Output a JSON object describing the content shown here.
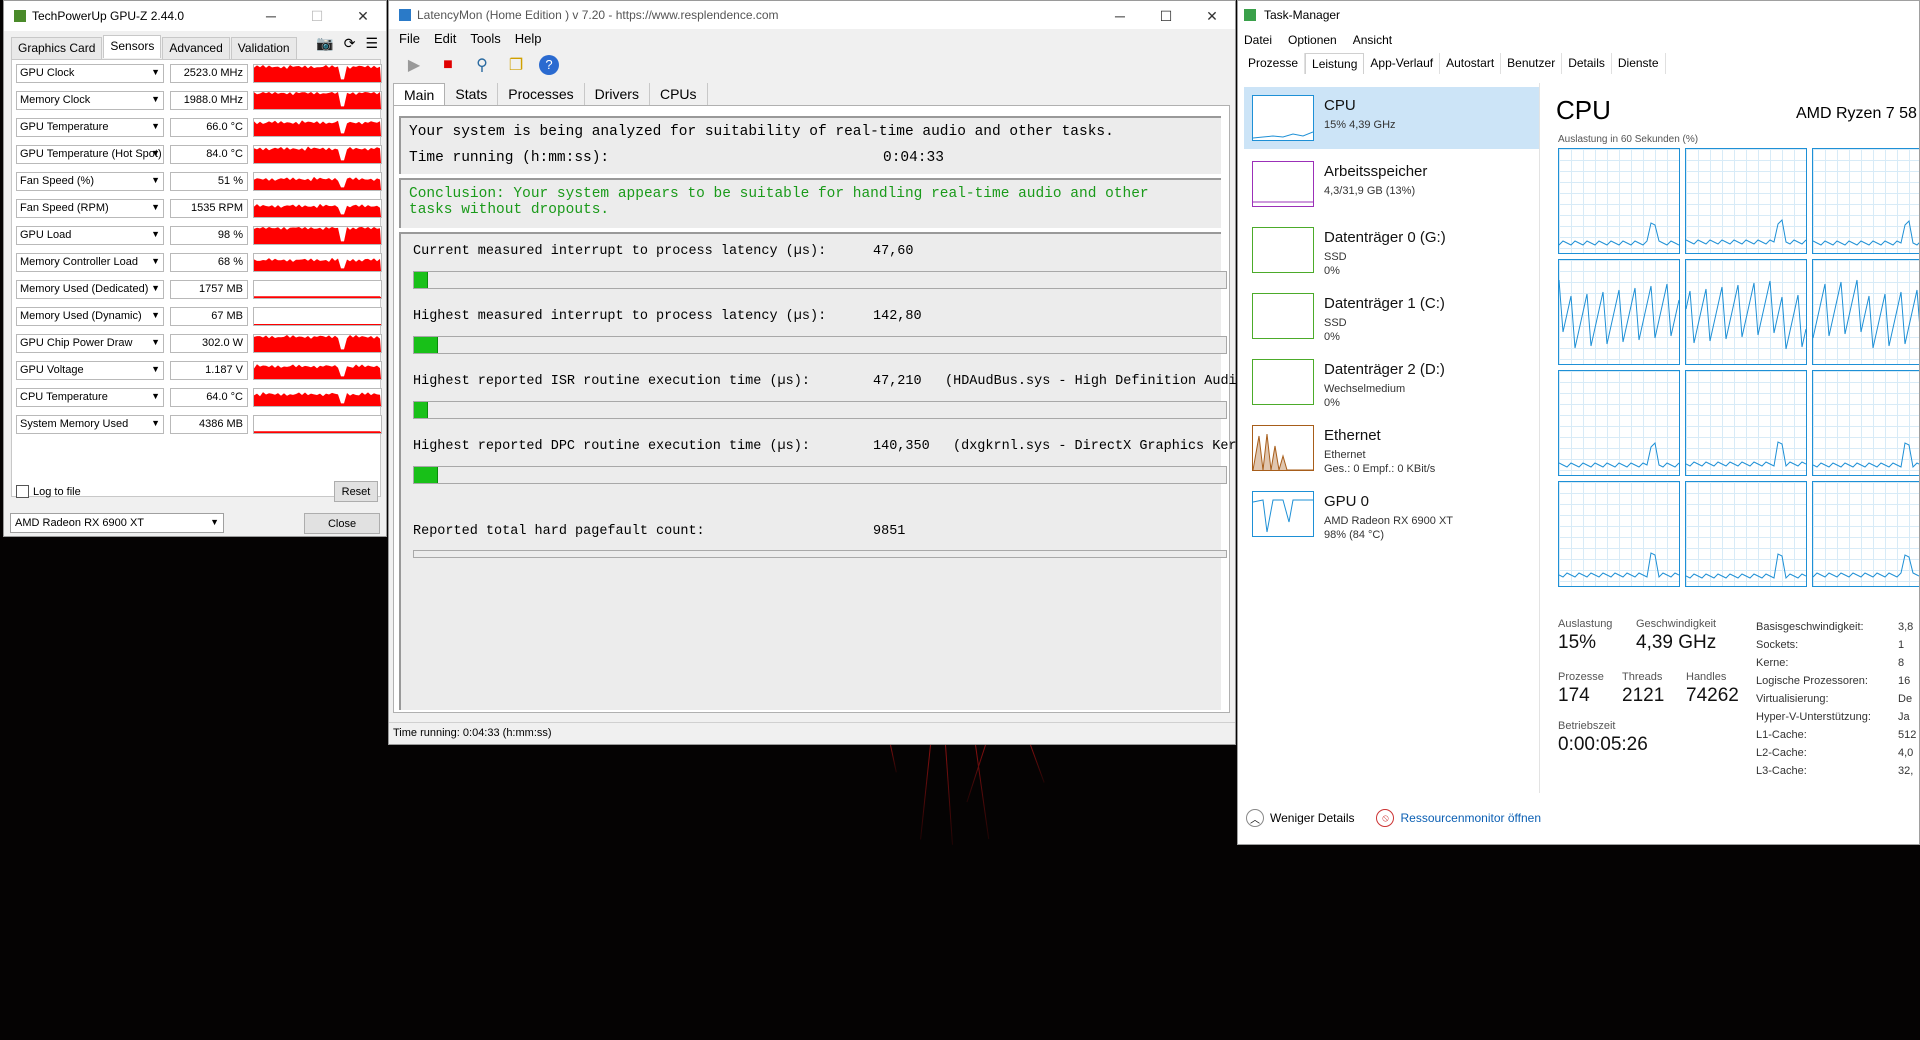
{
  "gpuz": {
    "title": "TechPowerUp GPU-Z 2.44.0",
    "tabs": [
      "Graphics Card",
      "Sensors",
      "Advanced",
      "Validation"
    ],
    "active_tab": "Sensors",
    "sensors": [
      {
        "label": "GPU Clock",
        "value": "2523.0 MHz",
        "level": 0.85
      },
      {
        "label": "Memory Clock",
        "value": "1988.0 MHz",
        "level": 0.9
      },
      {
        "label": "GPU Temperature",
        "value": "66.0 °C",
        "level": 0.75
      },
      {
        "label": "GPU Temperature (Hot Spot)",
        "value": "84.0 °C",
        "level": 0.8
      },
      {
        "label": "Fan Speed (%)",
        "value": "51 %",
        "level": 0.6
      },
      {
        "label": "Fan Speed (RPM)",
        "value": "1535 RPM",
        "level": 0.6
      },
      {
        "label": "GPU Load",
        "value": "98 %",
        "level": 0.9
      },
      {
        "label": "Memory Controller Load",
        "value": "68 %",
        "level": 0.6
      },
      {
        "label": "Memory Used (Dedicated)",
        "value": "1757 MB",
        "level": 0.1
      },
      {
        "label": "Memory Used (Dynamic)",
        "value": "67 MB",
        "level": 0.0
      },
      {
        "label": "GPU Chip Power Draw",
        "value": "302.0 W",
        "level": 0.85
      },
      {
        "label": "GPU Voltage",
        "value": "1.187 V",
        "level": 0.7
      },
      {
        "label": "CPU Temperature",
        "value": "64.0 °C",
        "level": 0.65
      },
      {
        "label": "System Memory Used",
        "value": "4386 MB",
        "level": 0.1
      }
    ],
    "log_to_file": "Log to file",
    "reset": "Reset",
    "gpu_select": "AMD Radeon RX 6900 XT",
    "close": "Close",
    "graph_color": "#ff0000"
  },
  "latencymon": {
    "title": "LatencyMon  (Home Edition )  v 7.20 - https://www.resplendence.com",
    "menu": [
      "File",
      "Edit",
      "Tools",
      "Help"
    ],
    "tabs": [
      "Main",
      "Stats",
      "Processes",
      "Drivers",
      "CPUs"
    ],
    "active_tab": "Main",
    "analysis_line": "Your system is being analyzed for suitability of real-time audio and other tasks.",
    "time_running_label": "Time running (h:mm:ss):",
    "time_running_value": "0:04:33",
    "conclusion_line1": "Conclusion: Your system appears to be suitable for handling real-time audio and other",
    "conclusion_line2": "tasks without dropouts.",
    "conclusion_color": "#1a9a1a",
    "measurements": [
      {
        "label": "Current measured interrupt to process latency (µs):",
        "value": "47,60",
        "detail": "",
        "bar_fraction": 0.015
      },
      {
        "label": "Highest measured interrupt to process latency (µs):",
        "value": "142,80",
        "detail": "",
        "bar_fraction": 0.03
      },
      {
        "label": "Highest reported ISR routine execution time (µs):",
        "value": "47,210",
        "detail": "(HDAudBus.sys - High Definition Audi",
        "bar_fraction": 0.015
      },
      {
        "label": "Highest reported DPC routine execution time (µs):",
        "value": "140,350",
        "detail": "(dxgkrnl.sys - DirectX Graphics Ker",
        "bar_fraction": 0.03
      }
    ],
    "pagefault_label": "Reported total hard pagefault count:",
    "pagefault_value": "9851",
    "status": "Time running: 0:04:33  (h:mm:ss)",
    "bar_color": "#18c018"
  },
  "taskmanager": {
    "title": "Task-Manager",
    "menu": [
      "Datei",
      "Optionen",
      "Ansicht"
    ],
    "tabs": [
      "Prozesse",
      "Leistung",
      "App-Verlauf",
      "Autostart",
      "Benutzer",
      "Details",
      "Dienste"
    ],
    "active_tab": "Leistung",
    "resources": [
      {
        "name": "CPU",
        "sub1": "15% 4,39 GHz",
        "sub2": "",
        "sub3": "",
        "color": "#1e90d6",
        "selected": true
      },
      {
        "name": "Arbeitsspeicher",
        "sub1": "4,3/31,9 GB (13%)",
        "sub2": "",
        "sub3": "",
        "color": "#9b30b8",
        "selected": false
      },
      {
        "name": "Datenträger 0 (G:)",
        "sub1": "SSD",
        "sub2": "0%",
        "sub3": "",
        "color": "#4cab2a",
        "selected": false
      },
      {
        "name": "Datenträger 1 (C:)",
        "sub1": "SSD",
        "sub2": "0%",
        "sub3": "",
        "color": "#4cab2a",
        "selected": false
      },
      {
        "name": "Datenträger 2 (D:)",
        "sub1": "Wechselmedium",
        "sub2": "0%",
        "sub3": "",
        "color": "#4cab2a",
        "selected": false
      },
      {
        "name": "Ethernet",
        "sub1": "Ethernet",
        "sub2": "Ges.: 0 Empf.: 0 KBit/s",
        "sub3": "",
        "color": "#a75d1a",
        "selected": false
      },
      {
        "name": "GPU 0",
        "sub1": "AMD Radeon RX 6900 XT",
        "sub2": "98% (84 °C)",
        "sub3": "",
        "color": "#1e90d6",
        "selected": false
      }
    ],
    "cpu_heading": "CPU",
    "cpu_model": "AMD Ryzen 7 58",
    "graph_label": "Auslastung in 60 Sekunden (%)",
    "stats": {
      "auslastung_label": "Auslastung",
      "auslastung": "15%",
      "geschwindigkeit_label": "Geschwindigkeit",
      "geschwindigkeit": "4,39 GHz",
      "prozesse_label": "Prozesse",
      "prozesse": "174",
      "threads_label": "Threads",
      "threads": "2121",
      "handles_label": "Handles",
      "handles": "74262",
      "betriebszeit_label": "Betriebszeit",
      "betriebszeit": "0:00:05:26"
    },
    "specs": [
      {
        "k": "Basisgeschwindigkeit:",
        "v": "3,8"
      },
      {
        "k": "Sockets:",
        "v": "1"
      },
      {
        "k": "Kerne:",
        "v": "8"
      },
      {
        "k": "Logische Prozessoren:",
        "v": "16"
      },
      {
        "k": "Virtualisierung:",
        "v": "De"
      },
      {
        "k": "Hyper-V-Unterstützung:",
        "v": "Ja"
      },
      {
        "k": "L1-Cache:",
        "v": "512"
      },
      {
        "k": "L2-Cache:",
        "v": "4,0"
      },
      {
        "k": "L3-Cache:",
        "v": "32,"
      }
    ],
    "fewer_details": "Weniger Details",
    "resmon": "Ressourcenmonitor öffnen"
  }
}
